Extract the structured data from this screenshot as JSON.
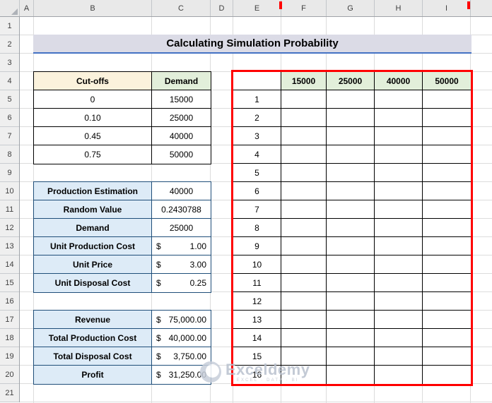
{
  "colors": {
    "red_border": "#FF0000",
    "green_bg": "#E2EFDA",
    "cream_bg": "#FBF2DC",
    "blue_bg": "#DDEBF7",
    "tbl_blue": "#1F4E79",
    "title_bg": "#DBDBE6",
    "title_border": "#4472C4"
  },
  "sheet": {
    "columns": [
      "A",
      "B",
      "C",
      "D",
      "E",
      "F",
      "G",
      "H",
      "I"
    ],
    "rows": [
      "1",
      "2",
      "3",
      "4",
      "5",
      "6",
      "7",
      "8",
      "9",
      "10",
      "11",
      "12",
      "13",
      "14",
      "15",
      "16",
      "17",
      "18",
      "19",
      "20",
      "21"
    ]
  },
  "title": "Calculating Simulation Probability",
  "cutoffs": {
    "headers": [
      "Cut-offs",
      "Demand"
    ],
    "rows": [
      [
        "0",
        "15000"
      ],
      [
        "0.10",
        "25000"
      ],
      [
        "0.45",
        "40000"
      ],
      [
        "0.75",
        "50000"
      ]
    ]
  },
  "params": {
    "rows": [
      {
        "label": "Production Estimation",
        "cur": "",
        "val": "40000"
      },
      {
        "label": "Random Value",
        "cur": "",
        "val": "0.2430788"
      },
      {
        "label": "Demand",
        "cur": "",
        "val": "25000"
      },
      {
        "label": "Unit Production Cost",
        "cur": "$",
        "val": "1.00"
      },
      {
        "label": "Unit Price",
        "cur": "$",
        "val": "3.00"
      },
      {
        "label": "Unit Disposal Cost",
        "cur": "$",
        "val": "0.25"
      }
    ]
  },
  "results": {
    "rows": [
      {
        "label": "Revenue",
        "cur": "$",
        "val": "75,000.00"
      },
      {
        "label": "Total Production Cost",
        "cur": "$",
        "val": "40,000.00"
      },
      {
        "label": "Total Disposal Cost",
        "cur": "$",
        "val": "3,750.00"
      },
      {
        "label": "Profit",
        "cur": "$",
        "val": "31,250.00"
      }
    ]
  },
  "sim": {
    "headers": [
      "15000",
      "25000",
      "40000",
      "50000"
    ],
    "rows": [
      "1",
      "2",
      "3",
      "4",
      "5",
      "6",
      "7",
      "8",
      "9",
      "10",
      "11",
      "12",
      "13",
      "14",
      "15",
      "16"
    ]
  },
  "watermark": {
    "name": "Exceldemy",
    "tagline": "EXCEL · DATA · BI"
  }
}
